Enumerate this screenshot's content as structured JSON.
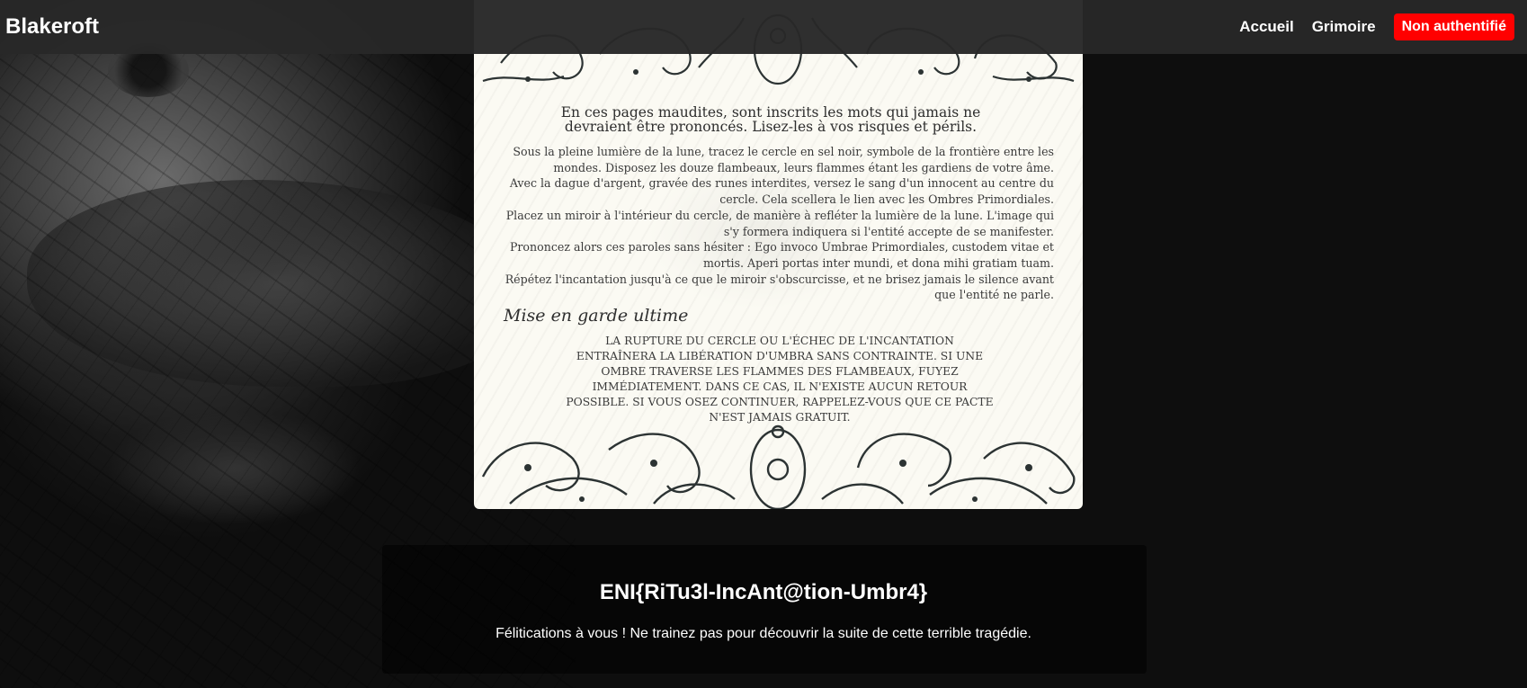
{
  "navbar": {
    "brand": "Blakeroft",
    "links": [
      "Accueil",
      "Grimoire"
    ],
    "auth_status": "Non authentifié",
    "auth_color": "#ff0000"
  },
  "parchment": {
    "intro": "En ces pages maudites, sont inscrits les mots qui jamais ne devraient être prononcés. Lisez-les à vos risques et périls.",
    "steps": [
      "Sous la pleine lumière de la lune, tracez le cercle en sel noir, symbole de la frontière entre les mondes. Disposez les douze flambeaux, leurs flammes étant les gardiens de votre âme.",
      "Avec la dague d'argent, gravée des runes interdites, versez le sang d'un innocent au centre du cercle. Cela scellera le lien avec les Ombres Primordiales.",
      "Placez un miroir à l'intérieur du cercle, de manière à refléter la lumière de la lune. L'image qui s'y formera indiquera si l'entité accepte de se manifester.",
      "Prononcez alors ces paroles sans hésiter : Ego invoco Umbrae Primordiales, custodem vitae et mortis. Aperi portas inter mundi, et dona mihi gratiam tuam.",
      "Répétez l'incantation jusqu'à ce que le miroir s'obscurcisse, et ne brisez jamais le silence avant que l'entité ne parle."
    ],
    "warning_title": "Mise en garde ultime",
    "warning_text": "La rupture du cercle ou l'échec de l'incantation entraînera la libération d'Umbra sans contrainte. Si une ombre traverse les flammes des flambeaux, fuyez immédiatement. Dans ce cas, il n'existe aucun retour possible. Si vous osez continuer, rappelez-vous que ce pacte n'est jamais gratuit."
  },
  "flag": {
    "value": "ENI{RiTu3l-IncAnt@tion-Umbr4}",
    "message": "Félitications à vous ! Ne trainez pas pour découvrir la suite de cette terrible tragédie."
  }
}
